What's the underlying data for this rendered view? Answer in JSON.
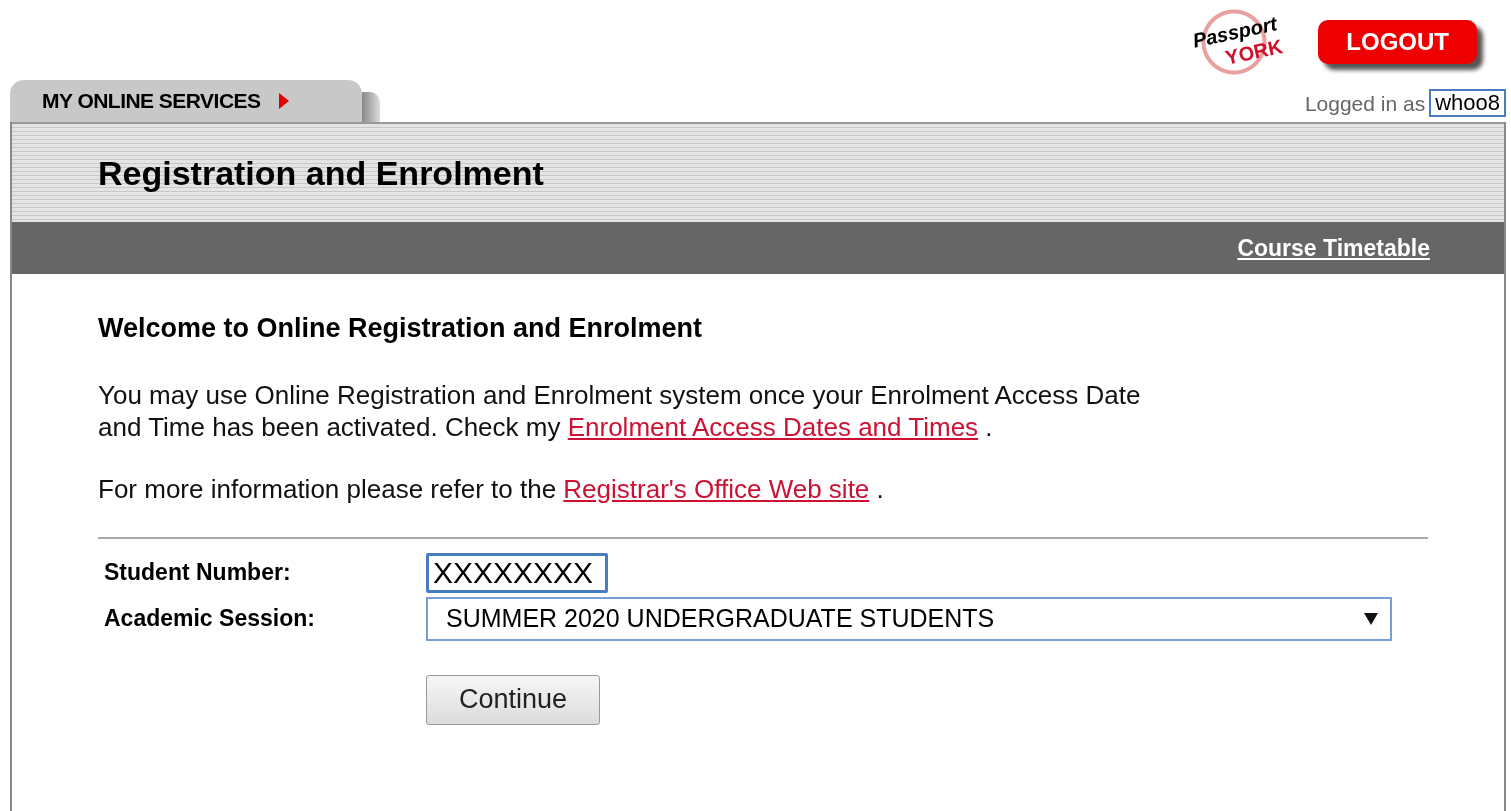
{
  "header": {
    "logo": {
      "line_1": "Passport",
      "line_2": "YORK"
    },
    "logout_button": "LOGOUT",
    "logged_in_label": "Logged in as",
    "username": "whoo8"
  },
  "tab": {
    "label": "MY ONLINE SERVICES"
  },
  "page_title": "Registration and Enrolment",
  "toolbar_links": [
    "Course Timetable"
  ],
  "welcome_heading": "Welcome to Online Registration and Enrolment",
  "paragraphs": [
    {
      "parts": [
        {
          "kind": "text",
          "text": "You may use Online Registration and Enrolment system once your Enrolment Access Date and Time has been activated. Check my "
        },
        {
          "kind": "link",
          "text": "Enrolment Access Dates and Times"
        },
        {
          "kind": "text",
          "text": " ."
        }
      ]
    },
    {
      "parts": [
        {
          "kind": "text",
          "text": "For more information please refer to the "
        },
        {
          "kind": "link",
          "text": "Registrar's Office Web site"
        },
        {
          "kind": "text",
          "text": " ."
        }
      ]
    }
  ],
  "form": {
    "student_number": {
      "label": "Student Number:",
      "value": "XXXXXXXX"
    },
    "academic_session": {
      "label": "Academic Session:",
      "value": "SUMMER 2020 UNDERGRADUATE STUDENTS"
    },
    "continue_button": "Continue"
  }
}
